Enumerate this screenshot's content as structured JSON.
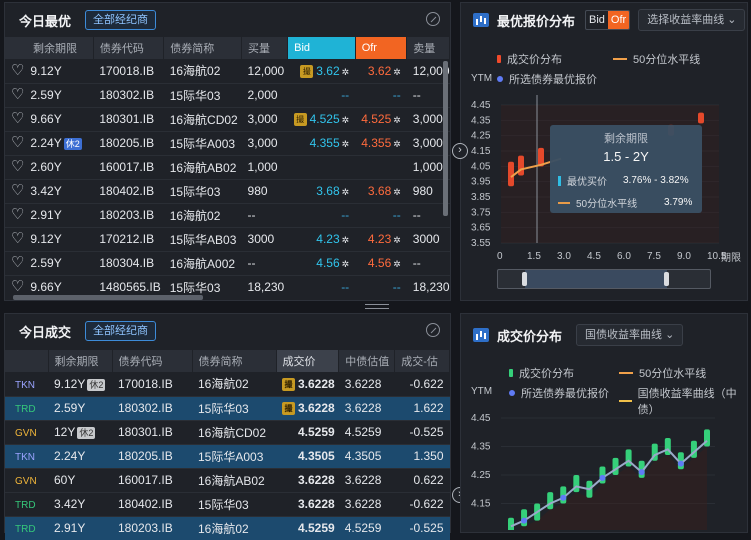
{
  "top_left": {
    "title": "今日最优",
    "broker_button": "全部经纪商",
    "columns": [
      "剩余期限",
      "债券代码",
      "债券简称",
      "买量",
      "Bid",
      "Ofr",
      "卖量"
    ],
    "rows": [
      {
        "term": "9.12Y",
        "tag": "",
        "code": "170018.IB",
        "name": "16海航02",
        "bid_vol": "12,000",
        "badge": true,
        "bid": "3.62",
        "ofr": "3.62",
        "ofr_vol": "12,000"
      },
      {
        "term": "2.59Y",
        "tag": "",
        "code": "180302.IB",
        "name": "15际华03",
        "bid_vol": "2,000",
        "badge": false,
        "bid": "--",
        "ofr": "--",
        "ofr_vol": "--"
      },
      {
        "term": "9.66Y",
        "tag": "",
        "code": "180301.IB",
        "name": "16海航CD02",
        "bid_vol": "3,000",
        "badge": true,
        "bid": "4.525",
        "ofr": "4.525",
        "ofr_vol": "3,000"
      },
      {
        "term": "2.24Y",
        "tag": "休2",
        "code": "180205.IB",
        "name": "15际华A003",
        "bid_vol": "3,000",
        "badge": false,
        "bid": "4.355",
        "ofr": "4.355",
        "ofr_vol": "3,000"
      },
      {
        "term": "2.60Y",
        "tag": "",
        "code": "160017.IB",
        "name": "16海航AB02",
        "bid_vol": "1,000",
        "badge": false,
        "bid": "",
        "ofr": "",
        "ofr_vol": "1,000"
      },
      {
        "term": "3.42Y",
        "tag": "",
        "code": "180402.IB",
        "name": "15际华03",
        "bid_vol": "980",
        "badge": false,
        "bid": "3.68",
        "ofr": "3.68",
        "ofr_vol": "980"
      },
      {
        "term": "2.91Y",
        "tag": "",
        "code": "180203.IB",
        "name": "16海航02",
        "bid_vol": "--",
        "badge": false,
        "bid": "--",
        "ofr": "--",
        "ofr_vol": "--"
      },
      {
        "term": "9.12Y",
        "tag": "",
        "code": "170212.IB",
        "name": "15际华AB03",
        "bid_vol": "3000",
        "badge": false,
        "bid": "4.23",
        "ofr": "4.23",
        "ofr_vol": "3000"
      },
      {
        "term": "2.59Y",
        "tag": "",
        "code": "180304.IB",
        "name": "16海航A002",
        "bid_vol": "--",
        "badge": false,
        "bid": "4.56",
        "ofr": "4.56",
        "ofr_vol": "--"
      },
      {
        "term": "9.66Y",
        "tag": "",
        "code": "1480565.IB",
        "name": "15际华03",
        "bid_vol": "18,230",
        "badge": false,
        "bid": "--",
        "ofr": "--",
        "ofr_vol": "18,230"
      }
    ]
  },
  "top_right": {
    "title": "最优报价分布",
    "seg_bid": "Bid",
    "seg_ofr": "Ofr",
    "dropdown": "选择收益率曲线",
    "legend": {
      "a": "成交价分布",
      "b": "50分位水平线",
      "c": "所选债券最优报价"
    },
    "ylabel": "YTM",
    "xlabel": "期限",
    "tooltip": {
      "head": "剩余期限",
      "range": "1.5 - 2Y",
      "row1_label": "最优买价",
      "row1_val": "3.76% - 3.82%",
      "row2_label": "50分位水平线",
      "row2_val": "3.79%"
    }
  },
  "bottom_left": {
    "title": "今日成交",
    "broker_button": "全部经纪商",
    "columns": [
      "剩余期限",
      "债券代码",
      "债券简称",
      "成交价",
      "中债估值",
      "成交-估"
    ],
    "rows": [
      {
        "src": "TKN",
        "term": "9.12Y",
        "tag": "休2",
        "code": "170018.IB",
        "name": "16海航02",
        "badge": true,
        "price": "3.6228",
        "val": "3.6228",
        "diff": "-0.622"
      },
      {
        "src": "TRD",
        "term": "2.59Y",
        "tag": "",
        "code": "180302.IB",
        "name": "15际华03",
        "badge": true,
        "price": "3.6228",
        "val": "3.6228",
        "diff": "1.622"
      },
      {
        "src": "GVN",
        "term": "12Y",
        "tag": "休2",
        "code": "180301.IB",
        "name": "16海航CD02",
        "badge": false,
        "price": "4.5259",
        "val": "4.5259",
        "diff": "-0.525"
      },
      {
        "src": "TKN",
        "term": "2.24Y",
        "tag": "",
        "code": "180205.IB",
        "name": "15际华A003",
        "badge": false,
        "price": "4.3505",
        "val": "4.3505",
        "diff": "1.350"
      },
      {
        "src": "GVN",
        "term": "60Y",
        "tag": "",
        "code": "160017.IB",
        "name": "16海航AB02",
        "badge": false,
        "price": "3.6228",
        "val": "3.6228",
        "diff": "0.622"
      },
      {
        "src": "TRD",
        "term": "3.42Y",
        "tag": "",
        "code": "180402.IB",
        "name": "15际华03",
        "badge": false,
        "price": "3.6228",
        "val": "3.6228",
        "diff": "-0.622"
      },
      {
        "src": "TRD",
        "term": "2.91Y",
        "tag": "",
        "code": "180203.IB",
        "name": "16海航02",
        "badge": false,
        "price": "4.5259",
        "val": "4.5259",
        "diff": "-0.525"
      }
    ]
  },
  "bottom_right": {
    "title": "成交价分布",
    "dropdown": "国债收益率曲线",
    "legend": {
      "a": "成交价分布",
      "b": "50分位水平线",
      "c": "所选债券最优报价",
      "d": "国债收益率曲线（中债）"
    },
    "ylabel": "YTM"
  },
  "chart_data": [
    {
      "type": "scatter",
      "ylabel": "YTM",
      "xlabel": "期限",
      "yticks": [
        "4.45",
        "4.35",
        "4.25",
        "4.15",
        "4.05",
        "3.95",
        "3.85",
        "3.75",
        "3.65",
        "3.55"
      ],
      "xticks": [
        "0",
        "1.5",
        "3.0",
        "4.5",
        "6.0",
        "7.5",
        "9.0",
        "10.5"
      ],
      "ylim": [
        3.55,
        4.45
      ],
      "series": [
        {
          "name": "成交价分布",
          "points": [
            {
              "x": 0.5,
              "low": 3.92,
              "high": 4.08
            },
            {
              "x": 1.0,
              "low": 3.99,
              "high": 4.12
            },
            {
              "x": 2.0,
              "low": 4.05,
              "high": 4.17
            },
            {
              "x": 8.5,
              "low": 4.25,
              "high": 4.32
            },
            {
              "x": 10.0,
              "low": 4.33,
              "high": 4.4
            }
          ]
        },
        {
          "name": "50分位水平线",
          "points": [
            {
              "x": 0.5,
              "y": 3.98
            },
            {
              "x": 1.0,
              "y": 4.03
            },
            {
              "x": 2.0,
              "y": 4.06
            },
            {
              "x": 3.0,
              "y": 4.1
            }
          ]
        }
      ]
    },
    {
      "type": "scatter",
      "ylabel": "YTM",
      "yticks": [
        "4.45",
        "4.35",
        "4.25",
        "4.15"
      ],
      "ylim": [
        4.05,
        4.45
      ],
      "series": [
        {
          "name": "成交价分布",
          "points": [
            4.07,
            4.1,
            4.12,
            4.16,
            4.18,
            4.22,
            4.2,
            4.25,
            4.28,
            4.31,
            4.27,
            4.33,
            4.35,
            4.3,
            4.34,
            4.38
          ]
        },
        {
          "name": "国债收益率曲线（中债）",
          "points": [
            4.07,
            4.09,
            4.12,
            4.15,
            4.17,
            4.21,
            4.2,
            4.24,
            4.27,
            4.3,
            4.26,
            4.32,
            4.34,
            4.29,
            4.33,
            4.37
          ]
        }
      ]
    }
  ]
}
